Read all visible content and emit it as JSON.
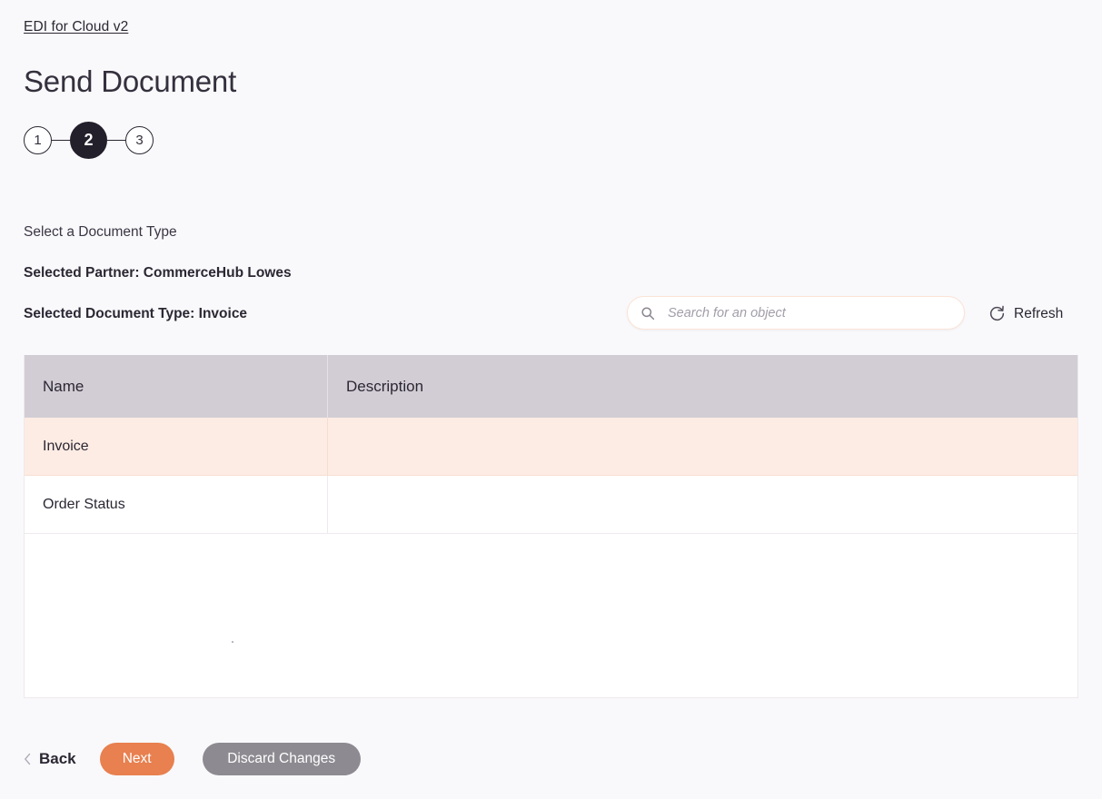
{
  "breadcrumb": {
    "label": "EDI for Cloud v2"
  },
  "header": {
    "title": "Send Document"
  },
  "stepper": {
    "steps": [
      {
        "number": "1",
        "state": "inactive"
      },
      {
        "number": "2",
        "state": "active"
      },
      {
        "number": "3",
        "state": "inactive"
      }
    ]
  },
  "selection": {
    "instruction": "Select a Document Type",
    "partner_line": "Selected Partner: CommerceHub Lowes",
    "doctype_line": "Selected Document Type: Invoice",
    "partner_value": "CommerceHub Lowes",
    "doctype_value": "Invoice"
  },
  "search": {
    "placeholder": "Search for an object",
    "value": "",
    "icon": "search-icon"
  },
  "refresh": {
    "label": "Refresh",
    "icon": "refresh-icon"
  },
  "table": {
    "columns": [
      "Name",
      "Description"
    ],
    "rows": [
      {
        "name": "Invoice",
        "description": "",
        "selected": true
      },
      {
        "name": "Order Status",
        "description": "",
        "selected": false
      }
    ]
  },
  "footer": {
    "back_label": "Back",
    "back_icon": "chevron-left-icon",
    "next_label": "Next",
    "discard_label": "Discard Changes"
  },
  "colors": {
    "background": "#f9f9fb",
    "accent_orange": "#e8804f",
    "neutral_gray": "#8e8a91",
    "table_header": "#d2cdd5",
    "row_selected": "#fdece4",
    "active_step": "#231f2b",
    "search_border": "#fbe3d6"
  }
}
